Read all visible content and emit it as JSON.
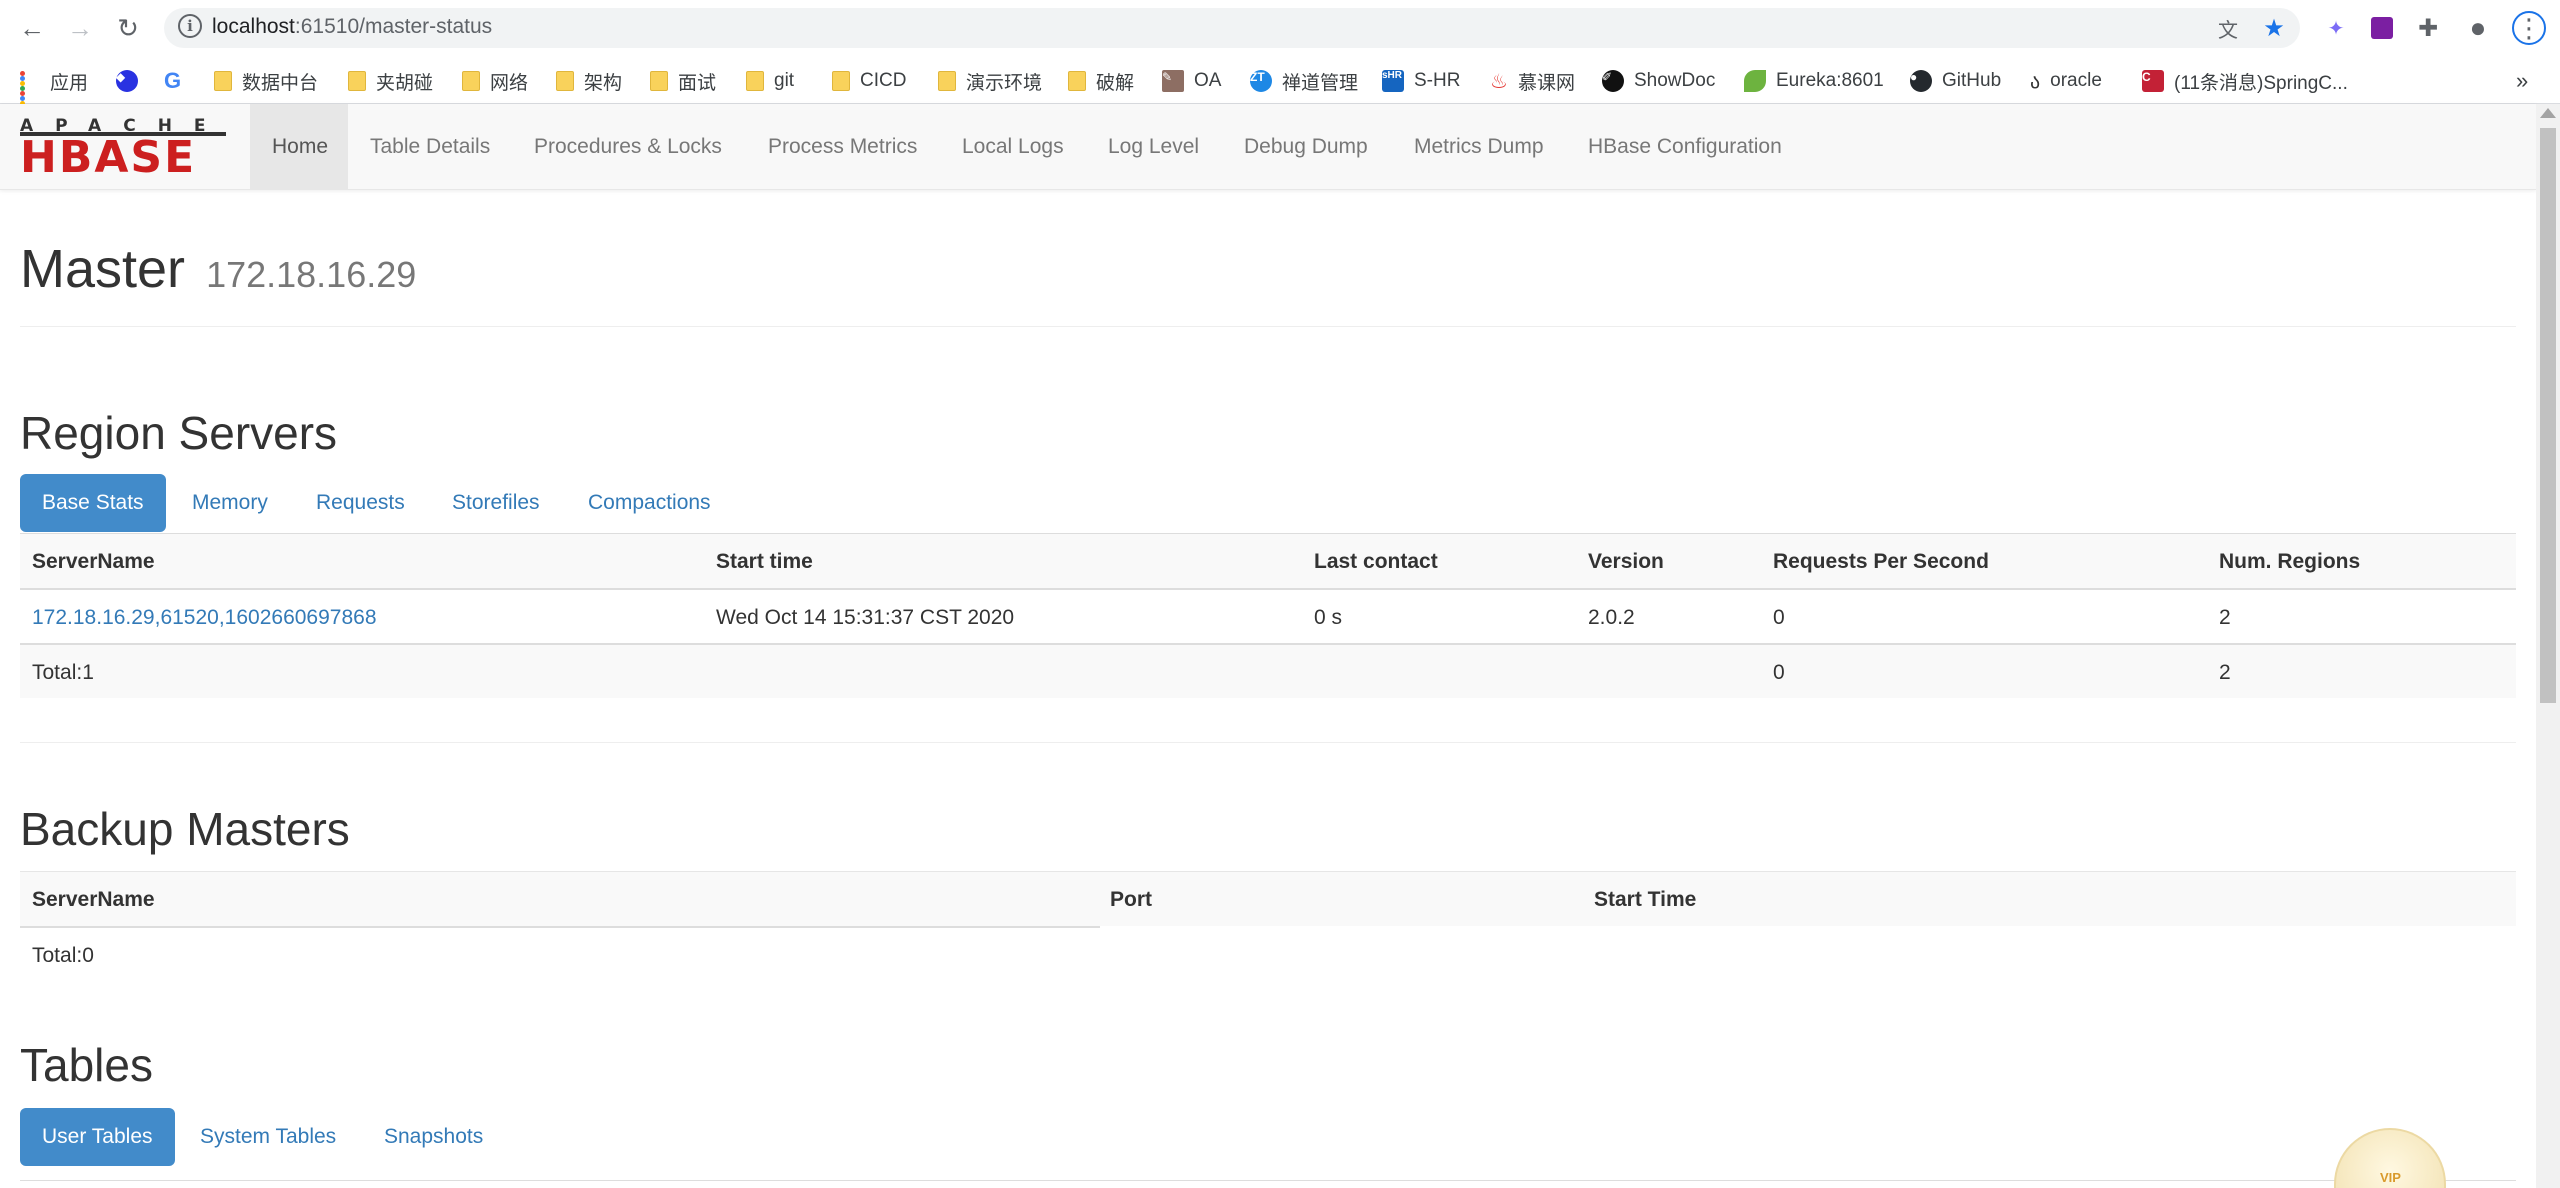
{
  "browser": {
    "url_host": "localhost",
    "url_path": ":61510/master-status",
    "bookmarks": [
      {
        "label": "应用",
        "icon": "apps-grid-icon"
      },
      {
        "label": "",
        "icon": "baidu-paw-icon"
      },
      {
        "label": "",
        "icon": "google-g-icon"
      },
      {
        "label": "数据中台",
        "icon": "folder-icon"
      },
      {
        "label": "夹胡碰",
        "icon": "folder-icon"
      },
      {
        "label": "网络",
        "icon": "folder-icon"
      },
      {
        "label": "架构",
        "icon": "folder-icon"
      },
      {
        "label": "面试",
        "icon": "folder-icon"
      },
      {
        "label": "git",
        "icon": "folder-icon"
      },
      {
        "label": "CICD",
        "icon": "folder-icon"
      },
      {
        "label": "演示环境",
        "icon": "folder-icon"
      },
      {
        "label": "破解",
        "icon": "folder-icon"
      },
      {
        "label": "OA",
        "icon": "oa-icon"
      },
      {
        "label": "禅道管理",
        "icon": "zentao-icon"
      },
      {
        "label": "S-HR",
        "icon": "shr-icon"
      },
      {
        "label": "慕课网",
        "icon": "flame-icon"
      },
      {
        "label": "ShowDoc",
        "icon": "showdoc-icon"
      },
      {
        "label": "Eureka:8601",
        "icon": "leaf-icon"
      },
      {
        "label": "GitHub",
        "icon": "github-icon"
      },
      {
        "label": "oracle",
        "icon": "oracle-icon"
      },
      {
        "label": "(11条消息)SpringC...",
        "icon": "csdn-icon"
      }
    ],
    "more_label": "»"
  },
  "navbar": {
    "logo_top": "APACHE",
    "logo_main": "HBASE",
    "items": [
      "Home",
      "Table Details",
      "Procedures & Locks",
      "Process Metrics",
      "Local Logs",
      "Log Level",
      "Debug Dump",
      "Metrics Dump",
      "HBase Configuration"
    ],
    "active_index": 0
  },
  "master": {
    "title": "Master",
    "host": "172.18.16.29"
  },
  "region_servers": {
    "title": "Region Servers",
    "tabs": [
      "Base Stats",
      "Memory",
      "Requests",
      "Storefiles",
      "Compactions"
    ],
    "active_tab": 0,
    "columns": [
      "ServerName",
      "Start time",
      "Last contact",
      "Version",
      "Requests Per Second",
      "Num. Regions"
    ],
    "rows": [
      [
        "172.18.16.29,61520,1602660697868",
        "Wed Oct 14 15:31:37 CST 2020",
        "0 s",
        "2.0.2",
        "0",
        "2"
      ]
    ],
    "total": {
      "label": "Total:1",
      "requests": "0",
      "regions": "2"
    }
  },
  "backup_masters": {
    "title": "Backup Masters",
    "columns": [
      "ServerName",
      "Port",
      "Start Time"
    ],
    "total": "Total:0"
  },
  "tables": {
    "title": "Tables",
    "tabs": [
      "User Tables",
      "System Tables",
      "Snapshots"
    ],
    "active_tab": 0
  },
  "vip_badge": "VIP",
  "colors": {
    "link": "#337ab7",
    "active_pill": "#428bca",
    "logo_red": "#cc1f1f"
  }
}
